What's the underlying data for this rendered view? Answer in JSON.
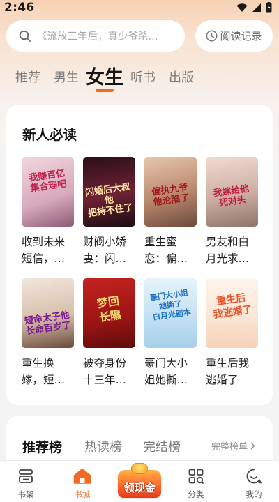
{
  "status_bar": {
    "time": "2:46"
  },
  "search": {
    "placeholder": "《流放三年后，真少爷杀..."
  },
  "history": {
    "label": "阅读记录"
  },
  "tabs": [
    "推荐",
    "男生",
    "女生",
    "听书",
    "出版"
  ],
  "active_tab": "女生",
  "new_reader": {
    "title": "新人必读",
    "books": [
      {
        "title": "收到未来短信，…",
        "cover_text": "我赚百亿\n集合理吧",
        "cover_bg": "#e9c2cf"
      },
      {
        "title": "财阀小娇妻：闪…",
        "cover_text": "闪婚后大叔他\n把持不住了",
        "cover_bg": "#3a1a24"
      },
      {
        "title": "重生蜜恋：偏…",
        "cover_text": "偏执九爷\n他沦陷了",
        "cover_bg": "#b7876a"
      },
      {
        "title": "男友和白月光求…",
        "cover_text": "我嫁给他\n死对头",
        "cover_bg": "#d9c0b8"
      },
      {
        "title": "重生换嫁，短…",
        "cover_text": "短命太子他\n长命百岁了",
        "cover_bg": "#e8d9cc"
      },
      {
        "title": "被夺身份十三年…",
        "cover_text": "梦回\n长隰",
        "cover_bg": "#b51c1c"
      },
      {
        "title": "豪门大小姐她撕…",
        "cover_text": "豪门大小姐\n她撕了\n白月光剧本",
        "cover_bg": "#cfe6f5"
      },
      {
        "title": "重生后我逃婚了",
        "cover_text": "重生后\n我逃婚了",
        "cover_bg": "#fbeee2"
      }
    ]
  },
  "recommend": {
    "tabs": [
      "推荐榜",
      "热读榜",
      "完结榜"
    ],
    "link": "完整榜单"
  },
  "bottom_nav": {
    "items": [
      {
        "label": "书架",
        "icon": "bookshelf-icon"
      },
      {
        "label": "书城",
        "icon": "home-icon"
      },
      {
        "label": "领现金",
        "icon": "cash-icon"
      },
      {
        "label": "分类",
        "icon": "category-icon"
      },
      {
        "label": "我的",
        "icon": "profile-icon"
      }
    ]
  },
  "colors": {
    "accent": "#f46b1b",
    "nav_active": "#f26a21"
  }
}
